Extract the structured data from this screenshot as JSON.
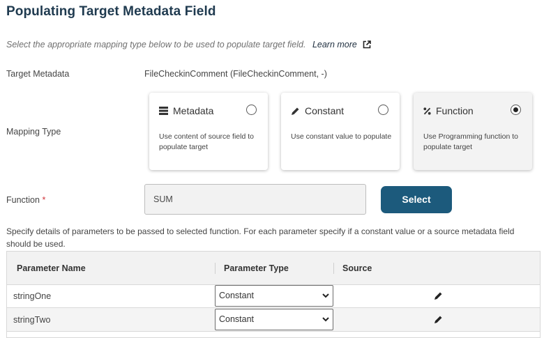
{
  "header": {
    "title": "Populating Target Metadata Field",
    "subtitle": "Select the appropriate mapping type below to be used to populate target field.",
    "learn_more": "Learn more"
  },
  "target_metadata": {
    "label": "Target Metadata",
    "value": "FileCheckinComment (FileCheckinComment, -)"
  },
  "mapping_type": {
    "label": "Mapping Type",
    "options": [
      {
        "title": "Metadata",
        "icon": "list-icon",
        "description": "Use content of source field to populate target",
        "selected": false
      },
      {
        "title": "Constant",
        "icon": "pencil-icon",
        "description": "Use constant value to populate",
        "selected": false
      },
      {
        "title": "Function",
        "icon": "percent-icon",
        "description": "Use Programming function to populate target",
        "selected": true
      }
    ]
  },
  "function": {
    "label": "Function",
    "required_mark": "*",
    "value": "SUM",
    "select_button": "Select"
  },
  "parameters": {
    "description": "Specify details of parameters to be passed to selected function. For each parameter specify if a constant value or a source metadata field should be used.",
    "columns": [
      "Parameter Name",
      "Parameter Type",
      "Source"
    ],
    "rows": [
      {
        "name": "stringOne",
        "type": "Constant"
      },
      {
        "name": "stringTwo",
        "type": "Constant"
      }
    ]
  },
  "colors": {
    "title": "#1f3a4f",
    "button": "#1c5a7c",
    "required": "#d0343a"
  }
}
